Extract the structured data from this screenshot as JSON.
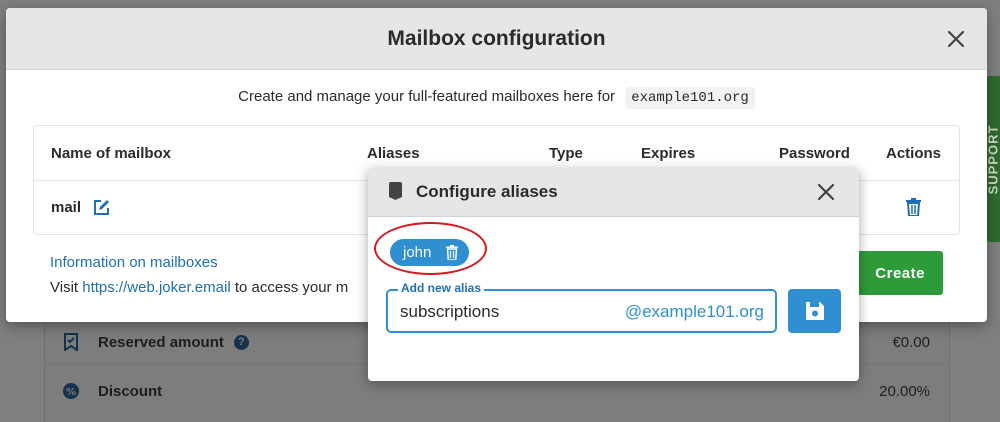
{
  "modal": {
    "title": "Mailbox configuration",
    "intro_text": "Create and manage your full-featured mailboxes here for",
    "domain": "example101.org",
    "close_icon": "close-icon"
  },
  "table": {
    "headers": [
      "Name of mailbox",
      "Aliases",
      "Type",
      "Expires",
      "Password",
      "Actions"
    ],
    "rows": [
      {
        "name": "mail"
      }
    ]
  },
  "footer": {
    "info_link": "Information on mailboxes",
    "visit_prefix": "Visit",
    "visit_link": "https://web.joker.email",
    "visit_suffix": "to access your m",
    "create_label": "Create"
  },
  "aliases_dialog": {
    "title": "Configure aliases",
    "aliases": [
      {
        "name": "john"
      }
    ],
    "input": {
      "legend": "Add new alias",
      "value": "subscriptions",
      "suffix": "@example101.org"
    }
  },
  "background": {
    "reserved_label": "Reserved amount",
    "reserved_value": "€0.00",
    "discount_label": "Discount",
    "discount_value": "20.00%",
    "support_label": "SUPPORT"
  },
  "colors": {
    "accent_blue": "#2f8fd1",
    "create_green": "#2e9b3a",
    "highlight_red": "#d8181f"
  }
}
